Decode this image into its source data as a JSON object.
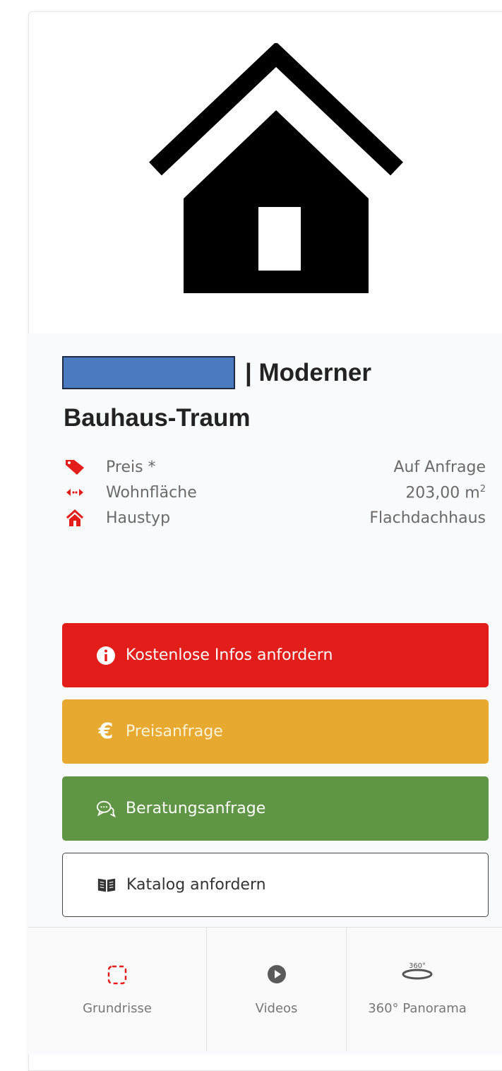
{
  "title": {
    "brand_masked": "",
    "line1": "| Moderner",
    "line2": "Bauhaus-Traum"
  },
  "specs": [
    {
      "icon": "price-tag-icon",
      "label": "Preis *",
      "value": "Auf Anfrage"
    },
    {
      "icon": "area-arrows-icon",
      "label": "Wohnfläche",
      "value": "203,00 m",
      "unit_sup": "2"
    },
    {
      "icon": "house-type-icon",
      "label": "Haustyp",
      "value": "Flachdachhaus"
    }
  ],
  "buttons": {
    "info": "Kostenlose Infos anfordern",
    "price": "Preisanfrage",
    "advice": "Beratungsanfrage",
    "catalog": "Katalog anfordern"
  },
  "tabs": [
    {
      "icon": "floorplan-icon",
      "label": "Grundrisse"
    },
    {
      "icon": "play-icon",
      "label": "Videos"
    },
    {
      "icon": "panorama-360-icon",
      "label": "360° Panorama",
      "badge": "360°"
    }
  ],
  "colors": {
    "info": "#e31d1a",
    "price": "#e8a930",
    "advice": "#5f9545",
    "masked_name": "#4b7abf"
  }
}
